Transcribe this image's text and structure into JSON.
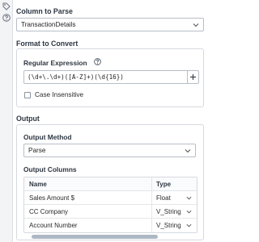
{
  "rail": {
    "icons": [
      "tag-icon",
      "help-icon"
    ]
  },
  "column_to_parse": {
    "label": "Column to Parse",
    "selected": "TransactionDetails"
  },
  "format_to_convert": {
    "label": "Format to Convert",
    "regex_label": "Regular Expression",
    "regex_value": "(\\d+\\.\\d+)([A-Z]+)(\\d{16})",
    "add_button": "+",
    "case_insensitive_label": "Case Insensitive",
    "case_insensitive_checked": false
  },
  "output": {
    "label": "Output",
    "method_label": "Output Method",
    "method_selected": "Parse",
    "columns_label": "Output Columns",
    "table": {
      "headers": [
        "Name",
        "Type"
      ],
      "rows": [
        {
          "name": "Sales Amount $",
          "type": "Float"
        },
        {
          "name": "CC Company",
          "type": "V_String"
        },
        {
          "name": "Account Number",
          "type": "V_String"
        }
      ]
    }
  },
  "colors": {
    "border": "#b8bec7",
    "label": "#2d3642",
    "scrollbar": "#aeb8c4"
  }
}
